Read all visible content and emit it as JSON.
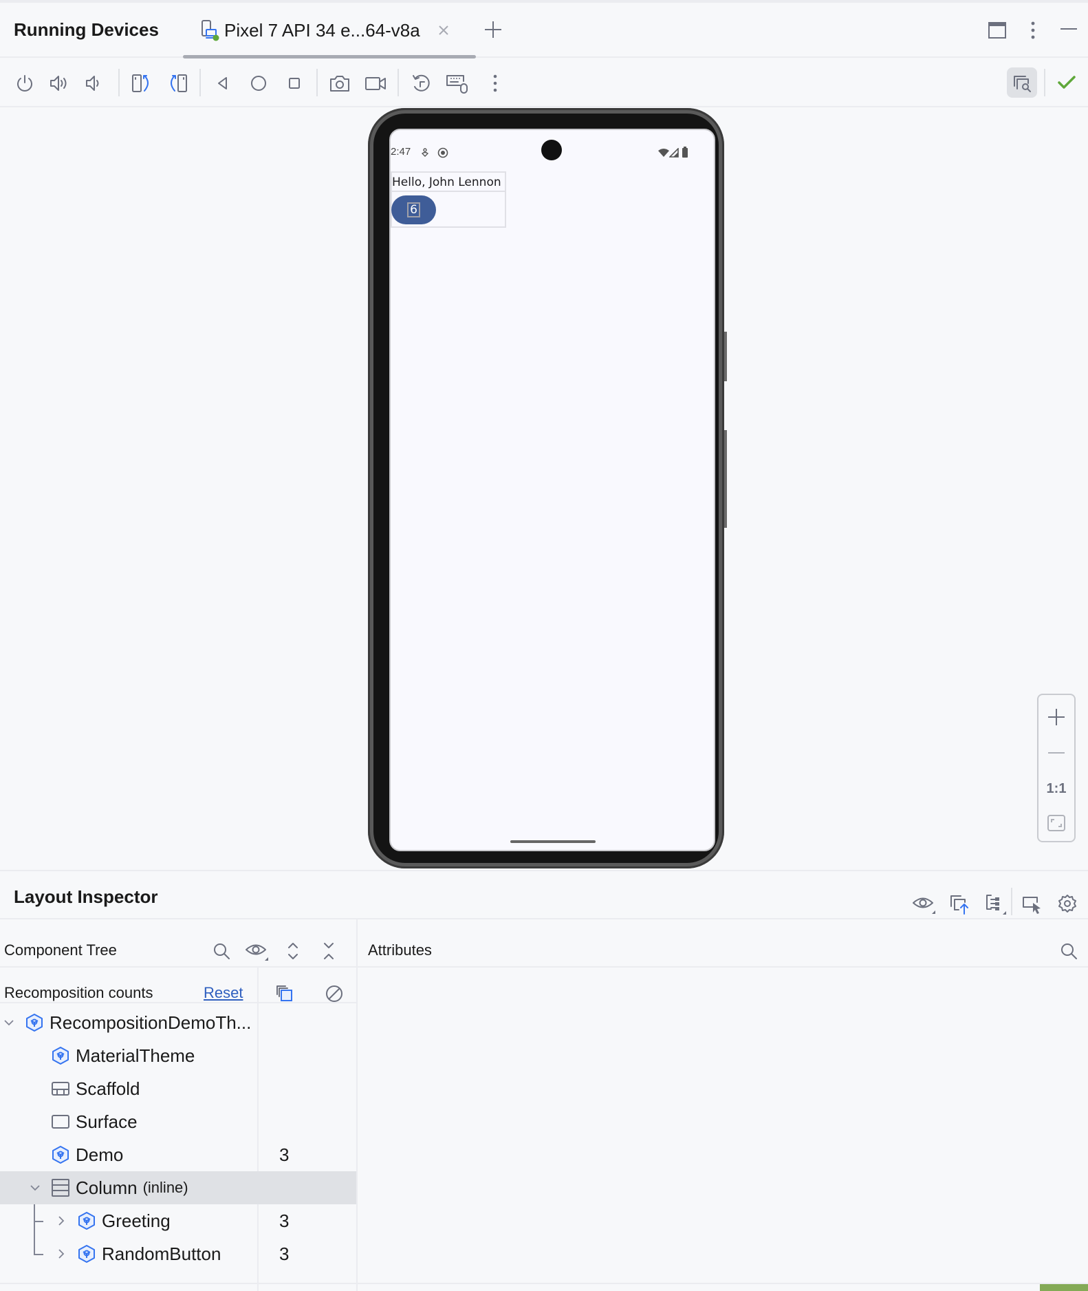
{
  "header": {
    "title": "Running Devices",
    "device_tab": "Pixel 7 API 34 e...64-v8a"
  },
  "toolbar": {
    "buttons": [
      "power",
      "volume-up",
      "volume-down",
      "rotate-left",
      "rotate-right",
      "back",
      "home",
      "overview",
      "screenshot",
      "screen-record",
      "reset-orientation",
      "keyboard-mouse",
      "more"
    ]
  },
  "device": {
    "status_time": "2:47",
    "greeting_text": "Hello, John Lennon",
    "button_value": "6"
  },
  "zoom_controls": {
    "zoom_in": "+",
    "zoom_out": "—",
    "actual_size": "1:1"
  },
  "layout_inspector": {
    "title": "Layout Inspector",
    "component_tree_label": "Component Tree",
    "attributes_label": "Attributes",
    "recomposition_label": "Recomposition counts",
    "reset_label": "Reset",
    "tree": [
      {
        "name": "RecompositionDemoTh...",
        "icon": "compose-icon",
        "count": "",
        "depth": 0,
        "expander": "expanded"
      },
      {
        "name": "MaterialTheme",
        "icon": "compose-icon",
        "count": "",
        "depth": 1,
        "expander": "none"
      },
      {
        "name": "Scaffold",
        "icon": "scaffold-icon",
        "count": "",
        "depth": 1,
        "expander": "none"
      },
      {
        "name": "Surface",
        "icon": "surface-icon",
        "count": "",
        "depth": 1,
        "expander": "none"
      },
      {
        "name": "Demo",
        "icon": "compose-icon",
        "count": "3",
        "depth": 1,
        "expander": "none"
      },
      {
        "name": "Column",
        "suffix": "(inline)",
        "icon": "column-icon",
        "count": "",
        "depth": 1,
        "expander": "expanded",
        "selected": true
      },
      {
        "name": "Greeting",
        "icon": "compose-icon",
        "count": "3",
        "depth": 2,
        "expander": "collapsed"
      },
      {
        "name": "RandomButton",
        "icon": "compose-icon",
        "count": "3",
        "depth": 2,
        "expander": "collapsed"
      }
    ]
  },
  "colors": {
    "accent": "#3574f0",
    "button": "#3f5d98",
    "success": "#5fa83a",
    "status_bar": "#84aa56"
  }
}
